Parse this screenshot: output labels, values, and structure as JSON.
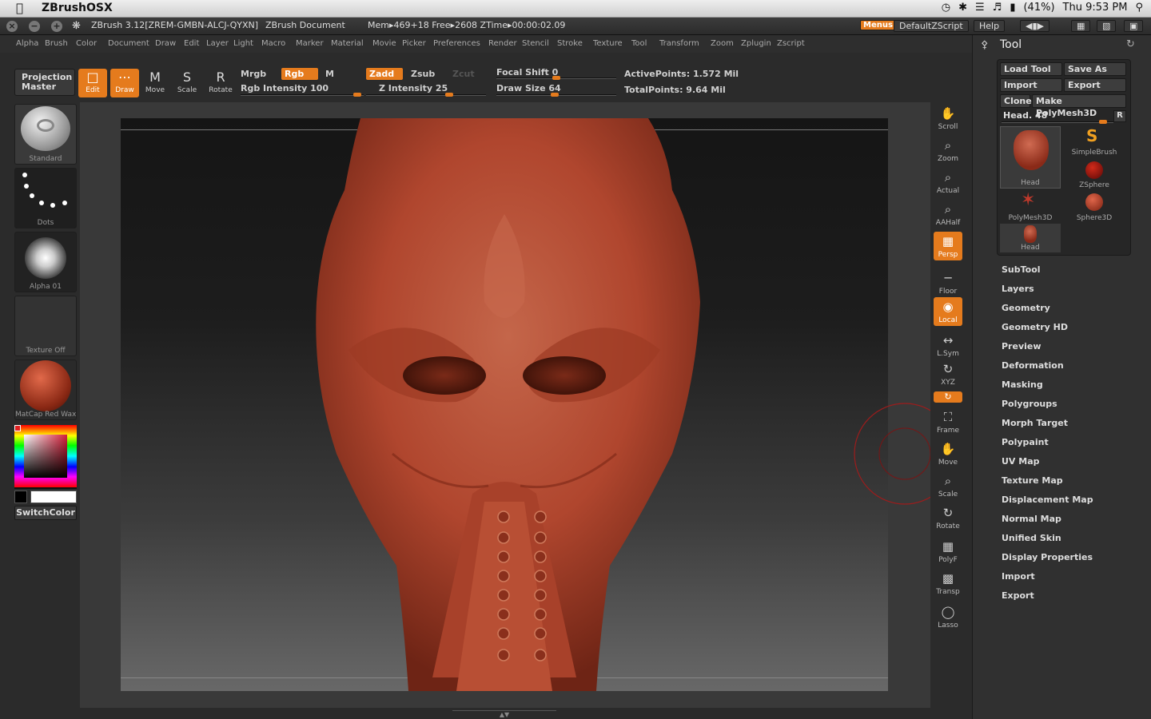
{
  "macbar": {
    "app_name": "ZBrushOSX",
    "battery": "(41%)",
    "clock": "Thu 9:53 PM"
  },
  "titlebar": {
    "app_title": "ZBrush 3.12[ZREM-GMBN-ALCJ-QYXN]",
    "document": "ZBrush Document",
    "stats": "Mem▸469+18 Free▸2608 ZTime▸00:00:02.09",
    "menus_btn": "Menus",
    "script_btn": "DefaultZScript",
    "help_btn": "Help"
  },
  "menus": [
    "Alpha",
    "Brush",
    "Color",
    "Document",
    "Draw",
    "Edit",
    "Layer",
    "Light",
    "Macro",
    "Marker",
    "Material",
    "Movie",
    "Picker",
    "Preferences",
    "Render",
    "Stencil",
    "Stroke",
    "Texture",
    "Tool",
    "Transform",
    "Zoom",
    "Zplugin",
    "Zscript"
  ],
  "shelf": {
    "projection_master": "Projection\nMaster",
    "edit": "Edit",
    "draw": "Draw",
    "move": "Move",
    "scale": "Scale",
    "rotate": "Rotate",
    "mrgb": "Mrgb",
    "rgb": "Rgb",
    "m": "M",
    "rgb_intensity": "Rgb Intensity 100",
    "rgb_intensity_value": 100,
    "zadd": "Zadd",
    "zsub": "Zsub",
    "zcut": "Zcut",
    "z_intensity": "Z Intensity 25",
    "z_intensity_value": 25,
    "focal_shift": "Focal Shift 0",
    "draw_size": "Draw Size 64",
    "active_points": "ActivePoints: 1.572 Mil",
    "total_points": "TotalPoints: 9.64 Mil"
  },
  "left_tray": {
    "brush": "Standard",
    "stroke": "Dots",
    "alpha": "Alpha 01",
    "texture": "Texture Off",
    "material": "MatCap Red Wax",
    "switch_color": "SwitchColor"
  },
  "right_shelf": [
    "Scroll",
    "Zoom",
    "Actual",
    "AAHalf",
    "Persp",
    "Floor",
    "Local",
    "L.Sym",
    "XYZ",
    "Frame",
    "Move",
    "Scale",
    "Rotate",
    "PolyF",
    "Transp",
    "Lasso"
  ],
  "tool_panel": {
    "title": "Tool",
    "load_tool": "Load Tool",
    "save_as": "Save As",
    "import": "Import",
    "export": "Export",
    "clone": "Clone",
    "make_polymesh": "Make PolyMesh3D",
    "current_tool": "Head. 48",
    "r_btn": "R",
    "thumbs": [
      "Head",
      "SimpleBrush",
      "ZSphere",
      "PolyMesh3D",
      "Sphere3D",
      "Head"
    ],
    "subpalettes": [
      "SubTool",
      "Layers",
      "Geometry",
      "Geometry HD",
      "Preview",
      "Deformation",
      "Masking",
      "Polygroups",
      "Morph Target",
      "Polypaint",
      "UV Map",
      "Texture Map",
      "Displacement Map",
      "Normal Map",
      "Unified Skin",
      "Display Properties",
      "Import",
      "Export"
    ]
  },
  "colors": {
    "accent": "#e57b1d",
    "panel": "#2b2b2b",
    "clay": "#b0462e"
  }
}
